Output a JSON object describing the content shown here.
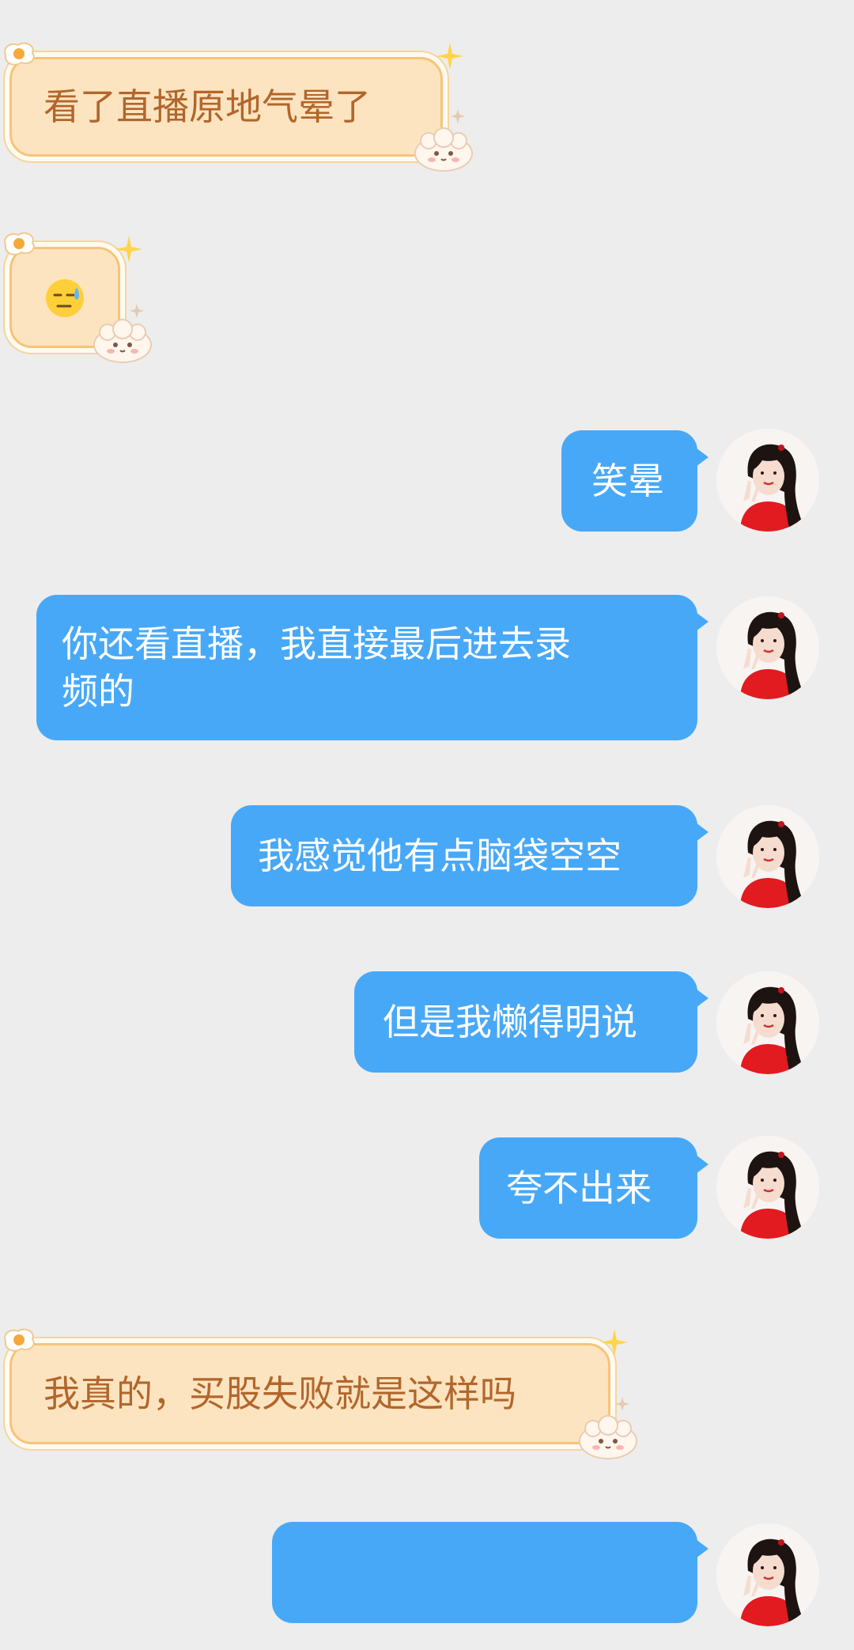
{
  "messages": [
    {
      "side": "in",
      "kind": "text",
      "text": "看了直播原地气晕了"
    },
    {
      "side": "in",
      "kind": "emoji",
      "emoji": "downcast-sweat-face"
    },
    {
      "side": "out",
      "kind": "text",
      "text": "笑晕"
    },
    {
      "side": "out",
      "kind": "text",
      "lines": [
        "你还看直播，我直接最后进去录",
        "频的"
      ]
    },
    {
      "side": "out",
      "kind": "text",
      "text": "我感觉他有点脑袋空空"
    },
    {
      "side": "out",
      "kind": "text",
      "text": "但是我懒得明说"
    },
    {
      "side": "out",
      "kind": "text",
      "text": "夸不出来"
    },
    {
      "side": "in",
      "kind": "text",
      "text": "我真的，买股失败就是这样吗"
    },
    {
      "side": "out",
      "kind": "text",
      "text": "",
      "blurred": true
    }
  ],
  "colors": {
    "background": "#ededed",
    "outgoing_bubble": "#48a8f8",
    "incoming_bubble": "#fde4c0",
    "incoming_border": "#f6c478",
    "incoming_text": "#b2662b"
  },
  "icons": {
    "bubble_corner": "fried-egg-icon",
    "bubble_decoration": "sparkle-icon",
    "bubble_mascot": "sheep-icon"
  }
}
